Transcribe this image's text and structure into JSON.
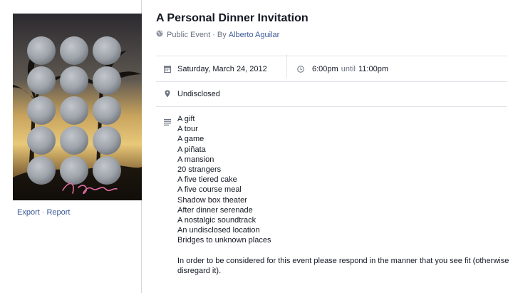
{
  "left": {
    "cover_alt": "Event cover photo",
    "links": {
      "export": "Export",
      "separator": "·",
      "report": "Report"
    }
  },
  "event": {
    "title": "A Personal Dinner Invitation",
    "privacy": "Public Event",
    "by_prefix": "· By",
    "host": "Alberto Aguilar"
  },
  "details": {
    "date": "Saturday, March 24, 2012",
    "start_time": "6:00pm",
    "until_word": "until",
    "end_time": "11:00pm",
    "location": "Undisclosed"
  },
  "description": {
    "lines": [
      "A gift",
      "A tour",
      "A game",
      "A piñata",
      "A mansion",
      "20 strangers",
      "A five tiered cake",
      "A five course meal",
      "Shadow box theater",
      "After dinner serenade",
      "A nostalgic soundtrack",
      "An undisclosed location",
      "Bridges to unknown places"
    ],
    "paragraph": "In order to be considered for this event please respond in the manner that you see fit (otherwise disregard it)."
  },
  "icons": {
    "privacy": "globe-icon",
    "date": "calendar-icon",
    "time": "clock-icon",
    "location": "map-pin-icon",
    "description": "text-lines-icon"
  },
  "colors": {
    "link": "#3b5998",
    "muted": "#6a7180",
    "divider": "#e1e3e8"
  }
}
